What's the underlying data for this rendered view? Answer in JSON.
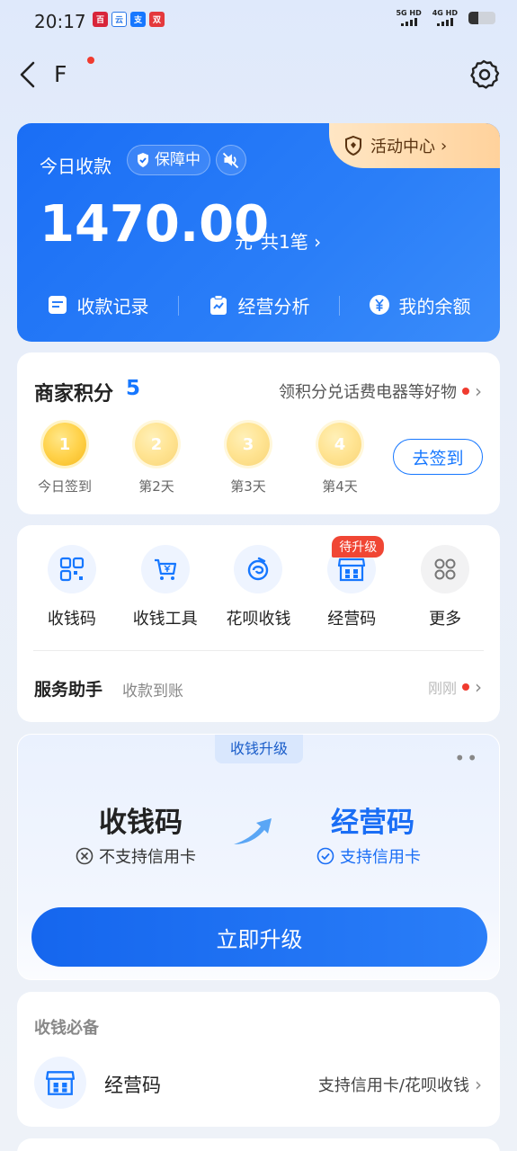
{
  "status_bar": {
    "time": "20:17",
    "apps": [
      "百",
      "云",
      "支",
      "双"
    ],
    "net1": "5G HD",
    "net2": "4G HD"
  },
  "header": {
    "title": "F"
  },
  "summary": {
    "label": "今日收款",
    "guard": "保障中",
    "activity": "活动中心",
    "amount": "1470.00",
    "unit": "元",
    "count": "共1笔",
    "actions": [
      "收款记录",
      "经营分析",
      "我的余额"
    ]
  },
  "points": {
    "title": "商家积分",
    "value": "5",
    "link": "领积分兑话费电器等好物",
    "days": [
      {
        "num": "1",
        "label": "今日签到"
      },
      {
        "num": "2",
        "label": "第2天"
      },
      {
        "num": "3",
        "label": "第3天"
      },
      {
        "num": "4",
        "label": "第4天"
      }
    ],
    "signin": "去签到"
  },
  "tools": {
    "items": [
      "收钱码",
      "收钱工具",
      "花呗收钱",
      "经营码",
      "更多"
    ],
    "badge": "待升级",
    "service_title": "服务助手",
    "service_sub": "收款到账",
    "service_time": "刚刚"
  },
  "upgrade": {
    "tag": "收钱升级",
    "more": "••",
    "left_title": "收钱码",
    "left_sub": "不支持信用卡",
    "right_title": "经营码",
    "right_sub": "支持信用卡",
    "button": "立即升级"
  },
  "must": {
    "title": "收钱必备",
    "name": "经营码",
    "desc": "支持信用卡/花呗收钱"
  },
  "colors": {
    "brand": "#1677ff",
    "alert": "#f03b2f",
    "gold": "#ffd24a"
  }
}
